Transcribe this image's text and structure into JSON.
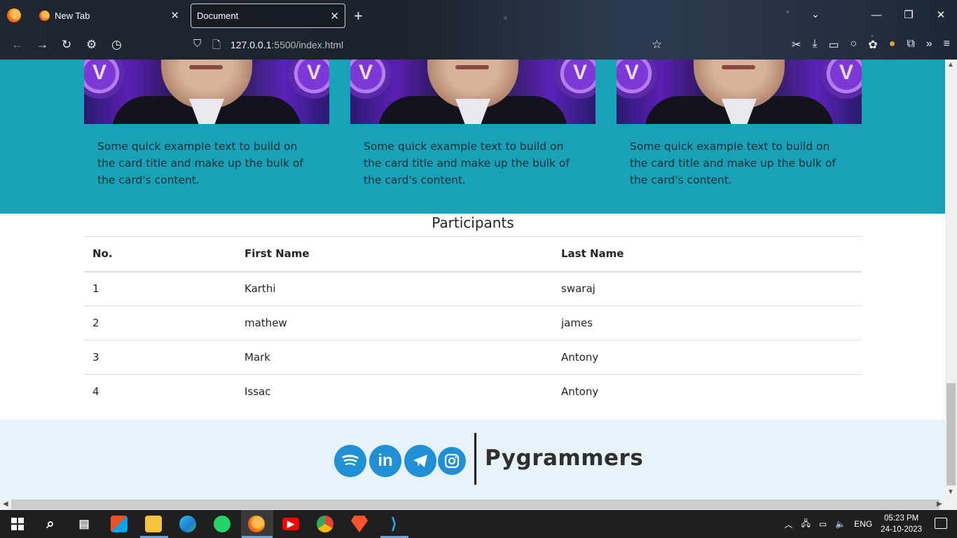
{
  "browser": {
    "tabs": [
      {
        "label": "New Tab",
        "close": "✕"
      },
      {
        "label": "Document",
        "close": "✕"
      }
    ],
    "new_tab_symbol": "+",
    "url_host": "127.0.0.1",
    "url_rest": ":5500/index.html",
    "window_controls": [
      "—",
      "❐",
      "✕"
    ],
    "nav_icons": [
      "back-icon",
      "forward-icon",
      "reload-icon",
      "settings-icon",
      "history-icon",
      "shield-icon",
      "page-icon"
    ],
    "toolbar_icons": [
      "star-icon",
      "screenshot-icon",
      "download-icon",
      "reader-icon",
      "circle-icon",
      "extension-icon",
      "cookie-icon",
      "puzzle-icon",
      "overflow-icon",
      "menu-icon"
    ]
  },
  "cards": [
    {
      "text": "Some quick example text to build on the card title and make up the bulk of the card's content."
    },
    {
      "text": "Some quick example text to build on the card title and make up the bulk of the card's content."
    },
    {
      "text": "Some quick example text to build on the card title and make up the bulk of the card's content."
    }
  ],
  "participants": {
    "title": "Participants",
    "headers": [
      "No.",
      "First Name",
      "Last Name"
    ],
    "rows": [
      [
        "1",
        "Karthi",
        "swaraj"
      ],
      [
        "2",
        "mathew",
        "james"
      ],
      [
        "3",
        "Mark",
        "Antony"
      ],
      [
        "4",
        "Issac",
        "Antony"
      ]
    ]
  },
  "footer": {
    "social_icons": [
      "spotify-icon",
      "linkedin-icon",
      "telegram-icon",
      "instagram-icon"
    ],
    "linkedin_text": "in",
    "brand": "Pygrammers"
  },
  "taskbar": {
    "apps": [
      "start-icon",
      "search-icon",
      "task-view-icon",
      "store-icon",
      "file-explorer-icon",
      "edge-icon",
      "whatsapp-icon",
      "firefox-icon",
      "youtube-icon",
      "chrome-icon",
      "brave-icon",
      "vscode-icon"
    ],
    "language": "ENG",
    "time": "05:23 PM",
    "date": "24-10-2023"
  },
  "colors": {
    "teal": "#17a2b8",
    "footer_bg": "#e7f2fb",
    "social_blue": "#1f8fd6"
  }
}
